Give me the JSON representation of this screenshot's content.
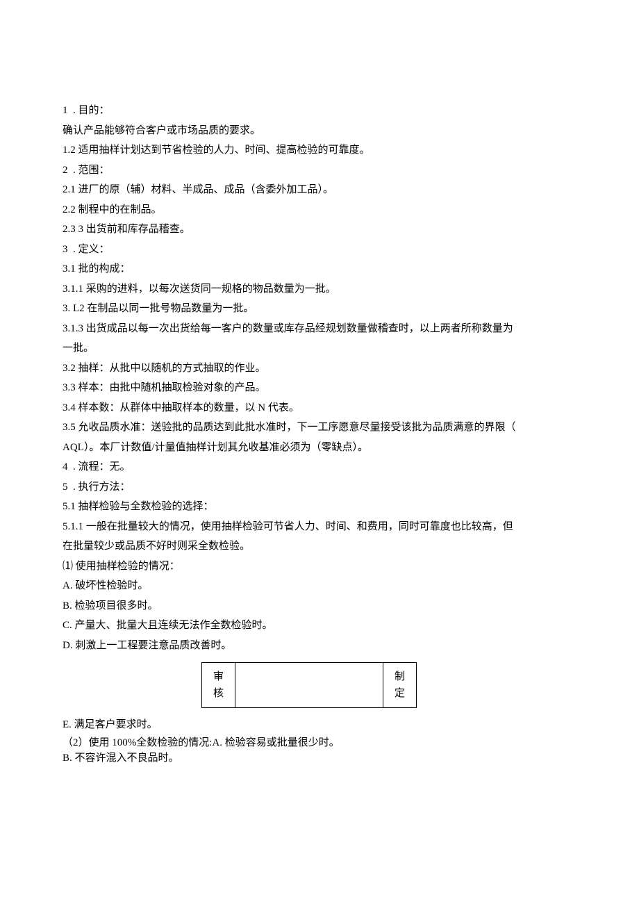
{
  "s1": {
    "num": "1",
    "title": ". 目的：",
    "p1": "确认产品能够符合客户或市场品质的要求。",
    "p2": "1.2 适用抽样计划达到节省检验的人力、时间、提高检验的可靠度。"
  },
  "s2": {
    "num": "2",
    "title": ". 范围：",
    "i1": "2.1  进厂的原（辅）材料、半成品、成品（含委外加工品）。",
    "i2": "2.2  制程中的在制品。",
    "i3": "2.3 3 出货前和库存品稽查。"
  },
  "s3": {
    "num": "3",
    "title": ". 定义：",
    "i1": "3.1  批的构成：",
    "i11": "3.1.1  采购的进料，以每次送货同一规格的物品数量为一批。",
    "i12": "3. L2 在制品以同一批号物品数量为一批。",
    "i13a": "3.1.3 出货成品以每一次出货给每一客户的数量或库存品经规划数量做稽查时，以上两者所称数量为",
    "i13b": "一批。",
    "i2": "3.2 抽样：从批中以随机的方式抽取的作业。",
    "i3": "3.3 样本：由批中随机抽取检验对象的产品。",
    "i4": "3.4 样本数：从群体中抽取样本的数量，以 N 代表。",
    "i5a": "3.5 允收品质水准：送验批的品质达到此批水准时，下一工序愿意尽量接受该批为品质满意的界限（",
    "i5b": "AQL）。本厂计数值/计量值抽样计划其允收基准必须为（零缺点）。"
  },
  "s4": {
    "num": "4",
    "title": ". 流程：无。"
  },
  "s5": {
    "num": "5",
    "title": ". 执行方法：",
    "i1": "5.1 抽样检验与全数检验的选择：",
    "i11a": "5.1.1 一般在批量较大的情况，使用抽样检验可节省人力、时间、和费用，同时可靠度也比较高，但",
    "i11b": "在批量较少或品质不好时则采全数检验。",
    "c1": "⑴ 使用抽样检验的情况：",
    "cA": "A. 破坏性检验时。",
    "cB": "B. 检验项目很多时。",
    "cC": "C. 产量大、批量大且连续无法作全数检验时。",
    "cD": "D. 刺激上一工程要注意品质改善时。",
    "cE": "E. 满足客户要求时。",
    "c2": "（2）使用 100%全数检验的情况:A. 检验容易或批量很少时。",
    "c2B": "B. 不容许混入不良品时。"
  },
  "table": {
    "audit": "审\n核",
    "blank1": "",
    "make": "制\n定",
    "blank2": ""
  }
}
